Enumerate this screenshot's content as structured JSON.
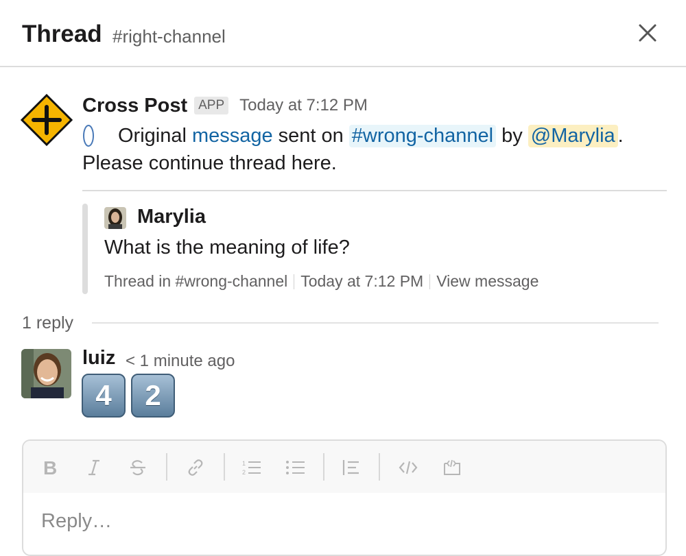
{
  "header": {
    "title": "Thread",
    "channel": "#right-channel",
    "close_icon": "close-icon"
  },
  "bot_message": {
    "author": "Cross Post",
    "badge": "APP",
    "timestamp": "Today at 7:12 PM",
    "text_original": "Original",
    "link_message": "message",
    "text_sent_on": "sent on",
    "channel_mention": "#wrong-channel",
    "text_by": "by",
    "user_mention": "@Marylia",
    "period": ".",
    "line2": "Please continue thread here.",
    "avatar_icon": "crossroads-sign-icon"
  },
  "attachment": {
    "author": "Marylia",
    "text": "What is the meaning of life?",
    "footer_thread": "Thread in #wrong-channel",
    "footer_time": "Today at 7:12 PM",
    "footer_link": "View message"
  },
  "replies": {
    "count_label": "1 reply",
    "items": [
      {
        "author": "luiz",
        "time": "< 1 minute ago",
        "emoji": [
          "4",
          "2"
        ]
      }
    ]
  },
  "composer": {
    "placeholder": "Reply…",
    "toolbar_icons": [
      "bold-icon",
      "italic-icon",
      "strikethrough-icon",
      "link-icon",
      "ordered-list-icon",
      "bulleted-list-icon",
      "blockquote-icon",
      "code-icon",
      "code-block-icon"
    ]
  },
  "colors": {
    "link": "#1264a3",
    "channel_bg": "#e8f5fa",
    "mention_bg": "#fcefc1",
    "muted": "#616061"
  }
}
